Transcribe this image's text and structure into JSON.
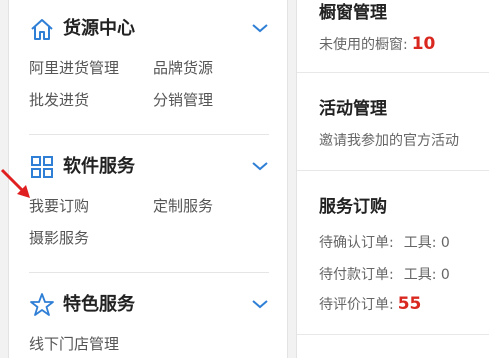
{
  "sidebar": {
    "sections": [
      {
        "title": "货源中心",
        "icon": "home-icon",
        "links": [
          "阿里进货管理",
          "品牌货源",
          "批发进货",
          "分销管理"
        ]
      },
      {
        "title": "软件服务",
        "icon": "grid-icon",
        "links": [
          "我要订购",
          "定制服务",
          "摄影服务"
        ]
      },
      {
        "title": "特色服务",
        "icon": "star-icon",
        "links": [
          "线下门店管理"
        ]
      }
    ]
  },
  "right": {
    "window_card": {
      "title": "橱窗管理",
      "unused_label": "未使用的橱窗:",
      "unused_count": "10"
    },
    "activity_card": {
      "title": "活动管理",
      "invite_text": "邀请我参加的官方活动"
    },
    "service_card": {
      "title": "服务订购",
      "rows": [
        {
          "label": "待确认订单:",
          "extra": "工具: 0"
        },
        {
          "label": "待付款订单:",
          "extra": "工具: 0"
        },
        {
          "label": "待评价订单:",
          "count": "55"
        }
      ]
    }
  },
  "colors": {
    "accent_blue": "#2f7fd6",
    "count_red": "#d9281f",
    "arrow_red": "#e02020"
  }
}
